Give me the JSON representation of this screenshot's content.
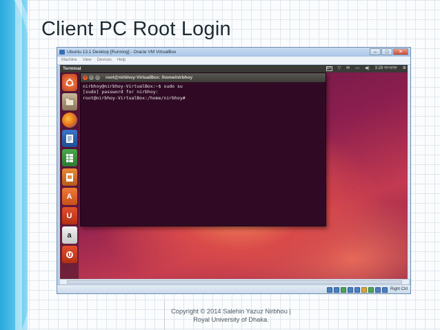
{
  "slide": {
    "title": "Client PC Root Login",
    "footer_line1": "Copyright © 2014 Salehin Yazuz Nirbhou |",
    "footer_line2": "Royal University of Dhaka."
  },
  "vbox": {
    "window_title": "Ubuntu 13.1 Desktop [Running] - Oracle VM VirtualBox",
    "menu": [
      "Machine",
      "View",
      "Devices",
      "Help"
    ],
    "host_key": "Right Ctrl"
  },
  "ubuntu": {
    "active_app": "Terminal",
    "clock": "3:29 অপরাহ্ন",
    "launcher_icons": [
      "ubuntu-dash",
      "files",
      "firefox",
      "libreoffice-writer",
      "libreoffice-calc",
      "libreoffice-impress",
      "ubuntu-software-center",
      "ubuntu-one",
      "amazon",
      "ubuntu-one-music"
    ]
  },
  "terminal": {
    "title": "root@nirbhoy-VirtualBox: /home/nirbhoy",
    "lines": [
      "nirbhoy@nirbhoy-VirtualBox:~$ sudo su",
      "[sudo] password for nirbhoy:",
      "root@nirbhoy-VirtualBox:/home/nirbhoy#"
    ]
  },
  "colors": {
    "terminal_bg": "#300a24",
    "ubuntu_orange": "#e35c2b",
    "slide_band": "#2aa7dd"
  }
}
